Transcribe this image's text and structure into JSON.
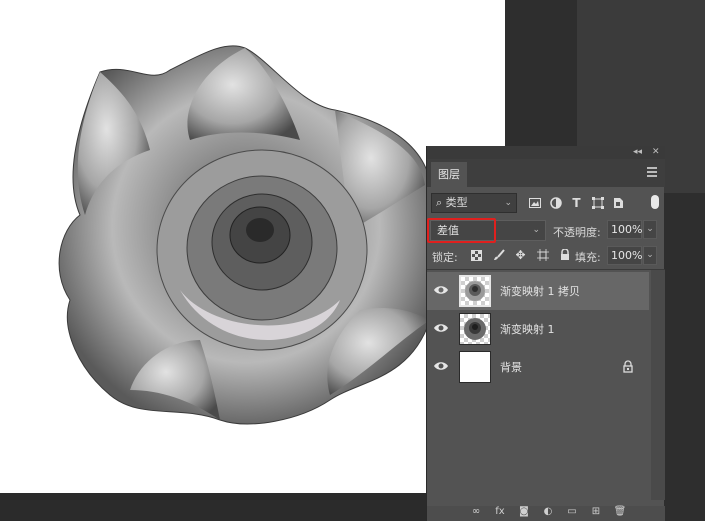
{
  "panel": {
    "tab_label": "图层",
    "filter": {
      "value": "类型",
      "icons": [
        "image-icon",
        "adjustment-icon",
        "text-icon",
        "shape-icon",
        "smart-object-icon"
      ]
    },
    "blend_mode": "差值",
    "opacity_label": "不透明度:",
    "opacity_value": "100%",
    "lock_label": "锁定:",
    "fill_label": "填充:",
    "fill_value": "100%"
  },
  "layers": [
    {
      "name": "渐变映射 1 拷贝",
      "selected": true,
      "visible": true
    },
    {
      "name": "渐变映射 1",
      "selected": false,
      "visible": true
    },
    {
      "name": "背景",
      "selected": false,
      "visible": true,
      "locked": true
    }
  ],
  "colors": {
    "highlight_box": "#e0201e",
    "panel_bg": "#535353",
    "selected_row": "#676767"
  }
}
